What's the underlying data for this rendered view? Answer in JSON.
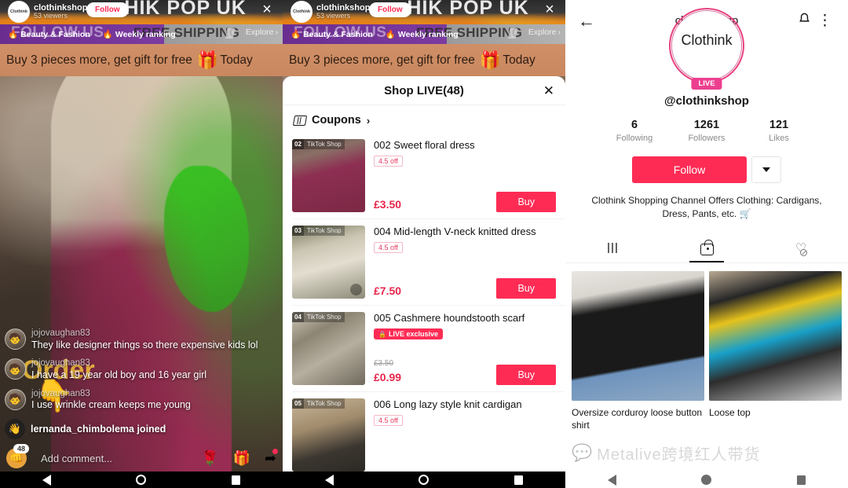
{
  "live": {
    "host_name": "clothinkshop",
    "host_views": "53 viewers",
    "host_avatar_text": "Clothink",
    "follow_label": "Follow",
    "close_icon": "×",
    "banner_big_text": "HIK POP UK",
    "categories": [
      {
        "emoji": "🔥",
        "label": "Beauty & Fashion"
      },
      {
        "emoji": "🔥",
        "label": "Weekly ranking"
      }
    ],
    "ghost_left": "FOLLOW US",
    "ghost_right": "FREE SHIPPING",
    "explore_label": "Explore",
    "explore_chevron": "›",
    "gift_text": "Buy 3 pieces more, get gift for free",
    "gift_emoji": "🎁",
    "gift_today": "Today",
    "order_watermark": "Order",
    "hand_emoji": "👇",
    "chat": [
      {
        "user": "jojovaughan83",
        "message": "They like designer things so there expensive kids lol"
      },
      {
        "user": "jojovaughan83",
        "message": "I have a 19 year old boy and 16 year girl"
      },
      {
        "user": "jojovaughan83",
        "message": "I use wrinkle cream keeps me young"
      }
    ],
    "join_event": "lernanda_chimbolema joined",
    "join_emoji": "👋",
    "comment_placeholder": "Add comment...",
    "comment_badge_count": "48",
    "comment_badge_emoji": "👊",
    "action_icons": [
      {
        "name": "rose-icon",
        "glyph": "🌹"
      },
      {
        "name": "gift-icon",
        "glyph": "🎁"
      },
      {
        "name": "share-icon",
        "glyph": "➦"
      }
    ]
  },
  "shop_sheet": {
    "title": "Shop LIVE(48)",
    "close_icon": "✕",
    "coupons_label": "Coupons",
    "coupons_chevron": "›",
    "buy_label": "Buy",
    "shop_tag": "TikTok Shop",
    "products": [
      {
        "index": "02",
        "name": "002 Sweet floral dress",
        "badge": "4.5 off",
        "badge_type": "off",
        "price": "£3.50",
        "old_price": "",
        "buy_label": "Buy"
      },
      {
        "index": "03",
        "name": "004 Mid-length V-neck knitted dress",
        "badge": "4.5 off",
        "badge_type": "off",
        "price": "£7.50",
        "old_price": "",
        "buy_label": "Buy"
      },
      {
        "index": "04",
        "name": "005 Cashmere houndstooth scarf",
        "badge": "LIVE exclusive",
        "badge_type": "live",
        "price": "£0.99",
        "old_price": "£3.50",
        "buy_label": "Buy"
      },
      {
        "index": "05",
        "name": "006 Long lazy style knit cardigan",
        "badge": "4.5 off",
        "badge_type": "off",
        "price": "",
        "old_price": "",
        "buy_label": ""
      }
    ]
  },
  "profile": {
    "header_title": "clothinkshop",
    "back_icon": "←",
    "bell_icon": "bell",
    "menu_icon": "⋮",
    "avatar_text": "Clothink",
    "live_badge": "LIVE",
    "handle": "@clothinkshop",
    "stats": [
      {
        "num": "6",
        "label": "Following"
      },
      {
        "num": "1261",
        "label": "Followers"
      },
      {
        "num": "121",
        "label": "Likes"
      }
    ],
    "follow_label": "Follow",
    "bio": "Clothink Shopping Channel Offers Clothing: Cardigans, Dress, Pants, etc. 🛒",
    "tabs": [
      {
        "name": "videos",
        "icon": "grid-icon",
        "active": false
      },
      {
        "name": "shop",
        "icon": "shopping-bag-icon",
        "active": true
      },
      {
        "name": "liked",
        "icon": "heart-private-icon",
        "active": false
      }
    ],
    "products": [
      {
        "name": "Oversize corduroy loose button shirt"
      },
      {
        "name": "Loose top"
      }
    ],
    "watermark": "Metalive跨境红人带货",
    "watermark_icon": "💬"
  },
  "colors": {
    "accent": "#fe2c55",
    "price": "#e8264c",
    "live_pink": "#ec3f8f",
    "banner_orange": "#c9885f",
    "purple": "#7c3ba0"
  }
}
